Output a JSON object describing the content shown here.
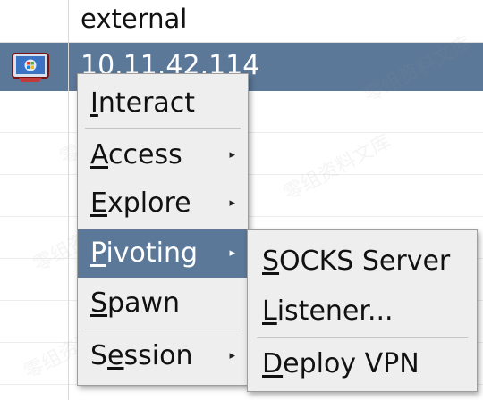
{
  "table": {
    "rows": [
      {
        "address": "external"
      },
      {
        "address": "10.11.42.114",
        "selected": true,
        "icon": "windows-host-icon"
      }
    ]
  },
  "watermark": {
    "text": "零组资料文库"
  },
  "context_menu": {
    "items": [
      {
        "pre": "",
        "mnemonic": "I",
        "post": "nteract",
        "submenu": false
      },
      {
        "pre": "",
        "mnemonic": "A",
        "post": "ccess",
        "submenu": true
      },
      {
        "pre": "",
        "mnemonic": "E",
        "post": "xplore",
        "submenu": true
      },
      {
        "pre": "",
        "mnemonic": "P",
        "post": "ivoting",
        "submenu": true,
        "active": true
      },
      {
        "pre": "",
        "mnemonic": "S",
        "post": "pawn",
        "submenu": false
      },
      {
        "pre": "S",
        "mnemonic": "e",
        "post": "ssion",
        "submenu": true
      }
    ],
    "submenu_arrow": "▸"
  },
  "pivoting_submenu": {
    "items": [
      {
        "pre": "",
        "mnemonic": "S",
        "post": "OCKS Server"
      },
      {
        "pre": "",
        "mnemonic": "L",
        "post": "istener..."
      },
      {
        "pre": "",
        "mnemonic": "D",
        "post": "eploy VPN"
      }
    ]
  },
  "colors": {
    "selection": "#5c7898",
    "menu_background": "#eeeeee"
  }
}
